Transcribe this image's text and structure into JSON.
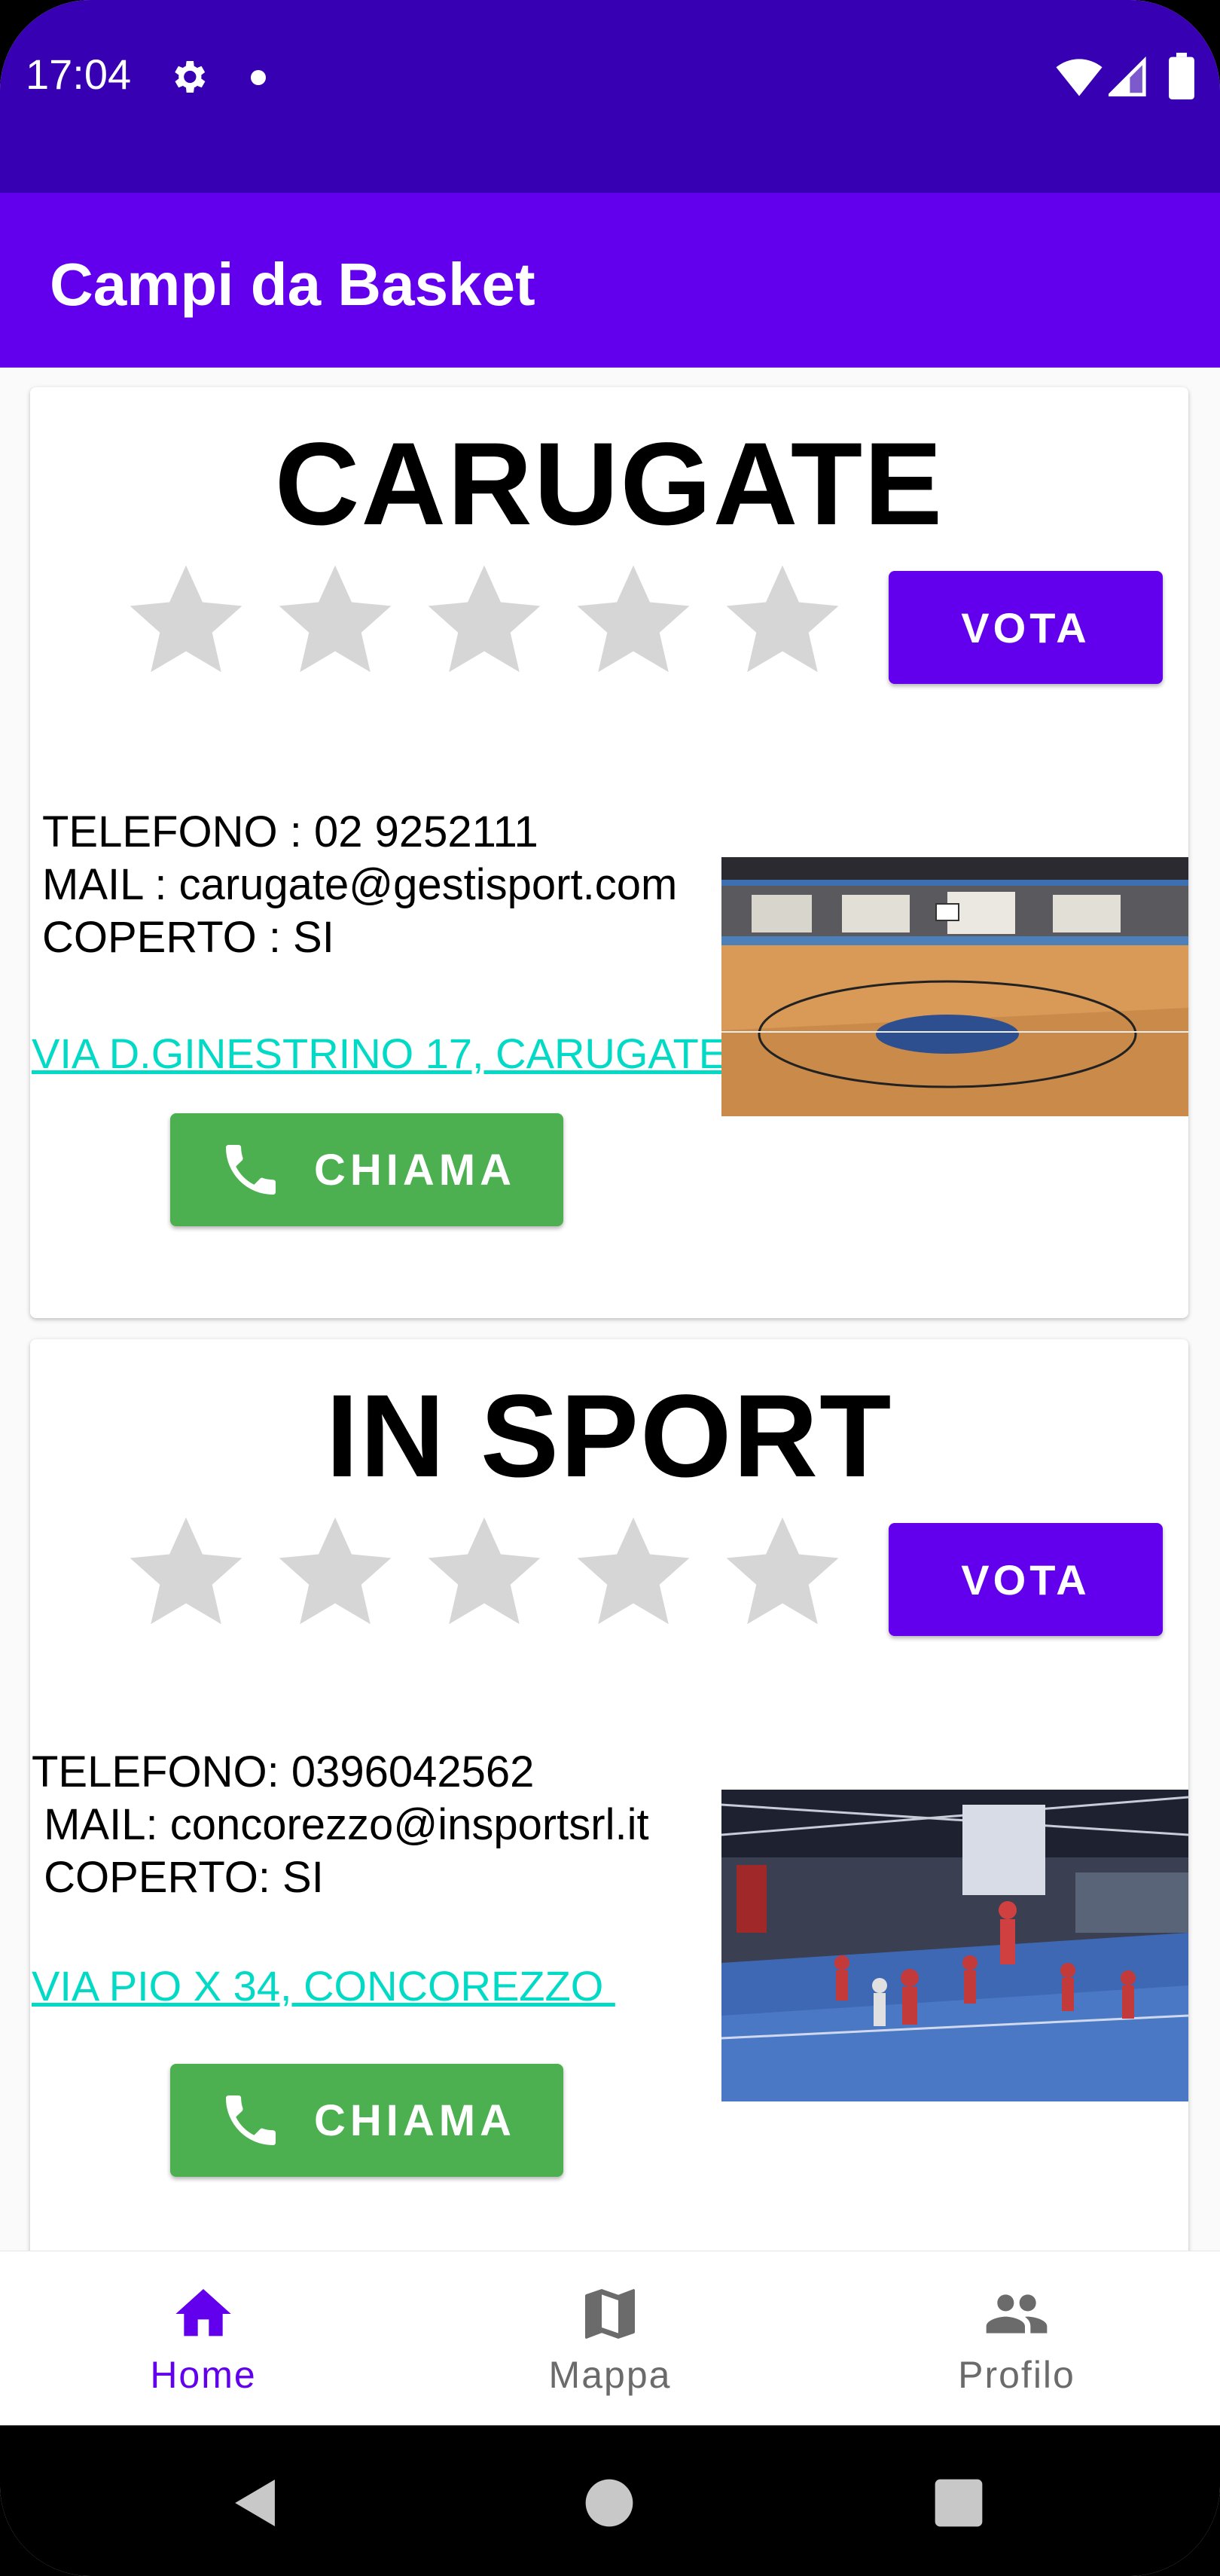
{
  "status_bar": {
    "time": "17:04",
    "icons": [
      "gear-icon",
      "dot-icon",
      "wifi-icon",
      "signal-icon",
      "battery-icon"
    ],
    "bg_color": "#3700b3"
  },
  "app_bar": {
    "title": "Campi da Basket",
    "bg_color": "#6200ee"
  },
  "courts": [
    {
      "name": "CARUGATE",
      "rating": 0,
      "stars": 5,
      "vote_label": "VOTA",
      "phone": "TELEFONO : 02 9252111",
      "mail": "MAIL : carugate@gestisport.com",
      "covered": "COPERTO : SI",
      "address": "VIA D.GINESTRINO 17, CARUGATE ",
      "call_label": "CHIAMA",
      "image": "indoor-basketball-court-photo"
    },
    {
      "name": "IN SPORT",
      "rating": 0,
      "stars": 5,
      "vote_label": "VOTA",
      "phone": "TELEFONO: 0396042562",
      "mail": " MAIL: concorezzo@insportsrl.it",
      "covered": " COPERTO: SI",
      "address": "VIA PIO X 34, CONCOREZZO ",
      "call_label": "CHIAMA",
      "image": "basketball-players-gym-photo"
    }
  ],
  "bottom_nav": {
    "items": [
      {
        "label": "Home",
        "icon": "home-icon",
        "active": true
      },
      {
        "label": "Mappa",
        "icon": "map-icon",
        "active": false
      },
      {
        "label": "Profilo",
        "icon": "people-icon",
        "active": false
      }
    ],
    "active_color": "#6200ee",
    "inactive_color": "#6b6b6b"
  },
  "system_nav": {
    "icons": [
      "back-icon",
      "home-circle-icon",
      "recents-icon"
    ]
  },
  "colors": {
    "primary": "#6200ee",
    "primary_dark": "#3700b3",
    "call_green": "#4caf50",
    "link_teal": "#03dac5",
    "star_grey": "#d6d6d6"
  }
}
